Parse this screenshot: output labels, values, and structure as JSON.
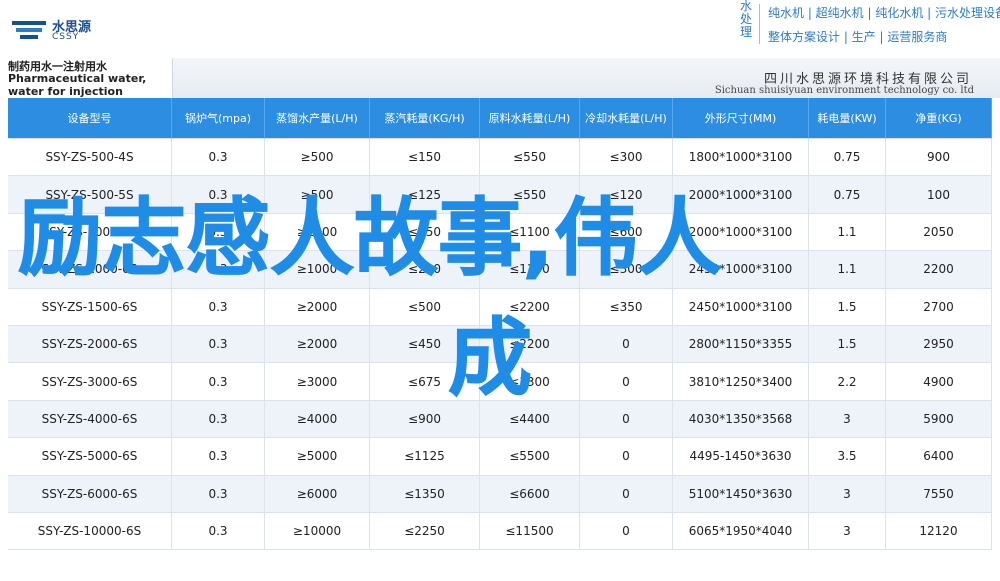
{
  "header": {
    "logo_cn": "水思源",
    "logo_en": "CSSY",
    "brand_vertical": "水处理",
    "brand_line1": "纯水机 | 超纯水机 | 纯化水机 | 污水处理设备",
    "brand_line2": "整体方案设计 | 生产 | 运营服务商"
  },
  "title": {
    "line1": "制药用水一注射用水",
    "line2": "Pharmaceutical water, water for injection",
    "company_cn": "四川水思源环境科技有限公司",
    "company_en": "Sichuan shuisiyuan environment technology co. ltd"
  },
  "table": {
    "headers": [
      "设备型号",
      "锅炉气(mpa)",
      "蒸馏水产量(L/H)",
      "蒸汽耗量(KG/H)",
      "原料水耗量(L/H)",
      "冷却水耗量(L/H)",
      "外形尺寸(MM)",
      "耗电量(KW)",
      "净重(KG)"
    ],
    "rows": [
      [
        "SSY-ZS-500-4S",
        "0.3",
        "≥500",
        "≤150",
        "≤550",
        "≤300",
        "1800*1000*3100",
        "0.75",
        "900"
      ],
      [
        "SSY-ZS-500-5S",
        "0.3",
        "≥500",
        "≤125",
        "≤550",
        "≤120",
        "2000*1000*3100",
        "0.75",
        "100"
      ],
      [
        "SSY-ZS-1000-4S",
        "0.3",
        "≥1000",
        "≤250",
        "≤1100",
        "≤600",
        "2000*1000*3100",
        "1.1",
        "2050"
      ],
      [
        "SSY-ZS-1000-6S",
        "0.3",
        "≥1000",
        "≤200",
        "≤1100",
        "≤300",
        "2450*1000*3100",
        "1.1",
        "2200"
      ],
      [
        "SSY-ZS-1500-6S",
        "0.3",
        "≥2000",
        "≤500",
        "≤2200",
        "≤350",
        "2450*1000*3100",
        "1.5",
        "2700"
      ],
      [
        "SSY-ZS-2000-6S",
        "0.3",
        "≥2000",
        "≤450",
        "≤2200",
        "0",
        "2800*1150*3355",
        "1.5",
        "2950"
      ],
      [
        "SSY-ZS-3000-6S",
        "0.3",
        "≥3000",
        "≤675",
        "≤3300",
        "0",
        "3810*1250*3400",
        "2.2",
        "4900"
      ],
      [
        "SSY-ZS-4000-6S",
        "0.3",
        "≥4000",
        "≤900",
        "≤4400",
        "0",
        "4030*1350*3568",
        "3",
        "5900"
      ],
      [
        "SSY-ZS-5000-6S",
        "0.3",
        "≥5000",
        "≤1125",
        "≤5500",
        "0",
        "4495-1450*3630",
        "3.5",
        "6400"
      ],
      [
        "SSY-ZS-6000-6S",
        "0.3",
        "≥6000",
        "≤1350",
        "≤6600",
        "0",
        "5100*1450*3630",
        "3",
        "7550"
      ],
      [
        "SSY-ZS-10000-6S",
        "0.3",
        "≥10000",
        "≤2250",
        "≤11500",
        "0",
        "6065*1950*4040",
        "3",
        "12120"
      ]
    ]
  },
  "overlay": {
    "line1": "励志感人故事,伟人",
    "line2": "成"
  },
  "colors": {
    "header_blue": "#2d8de0",
    "headline_blue": "#1f8ce6",
    "brand_blue": "#2f7bc4"
  }
}
